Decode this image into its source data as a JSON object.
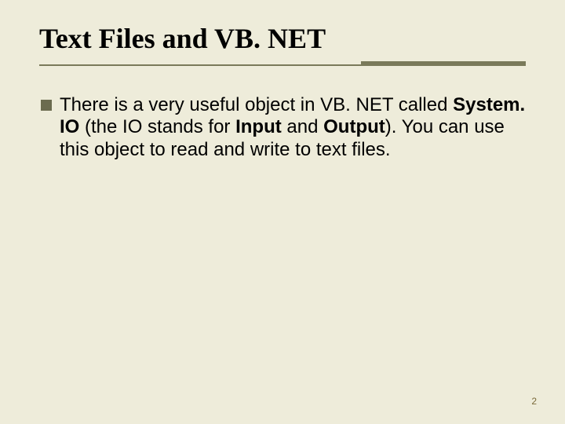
{
  "slide": {
    "title": "Text Files and VB. NET",
    "bullet": {
      "t1": "There is a very useful object in VB. NET called ",
      "b1": "System. IO",
      "t2": " (the IO stands for ",
      "b2": "Input",
      "t3": " and ",
      "b3": "Output",
      "t4": "). You can use this object to read and write to text files."
    },
    "page_number": "2"
  }
}
